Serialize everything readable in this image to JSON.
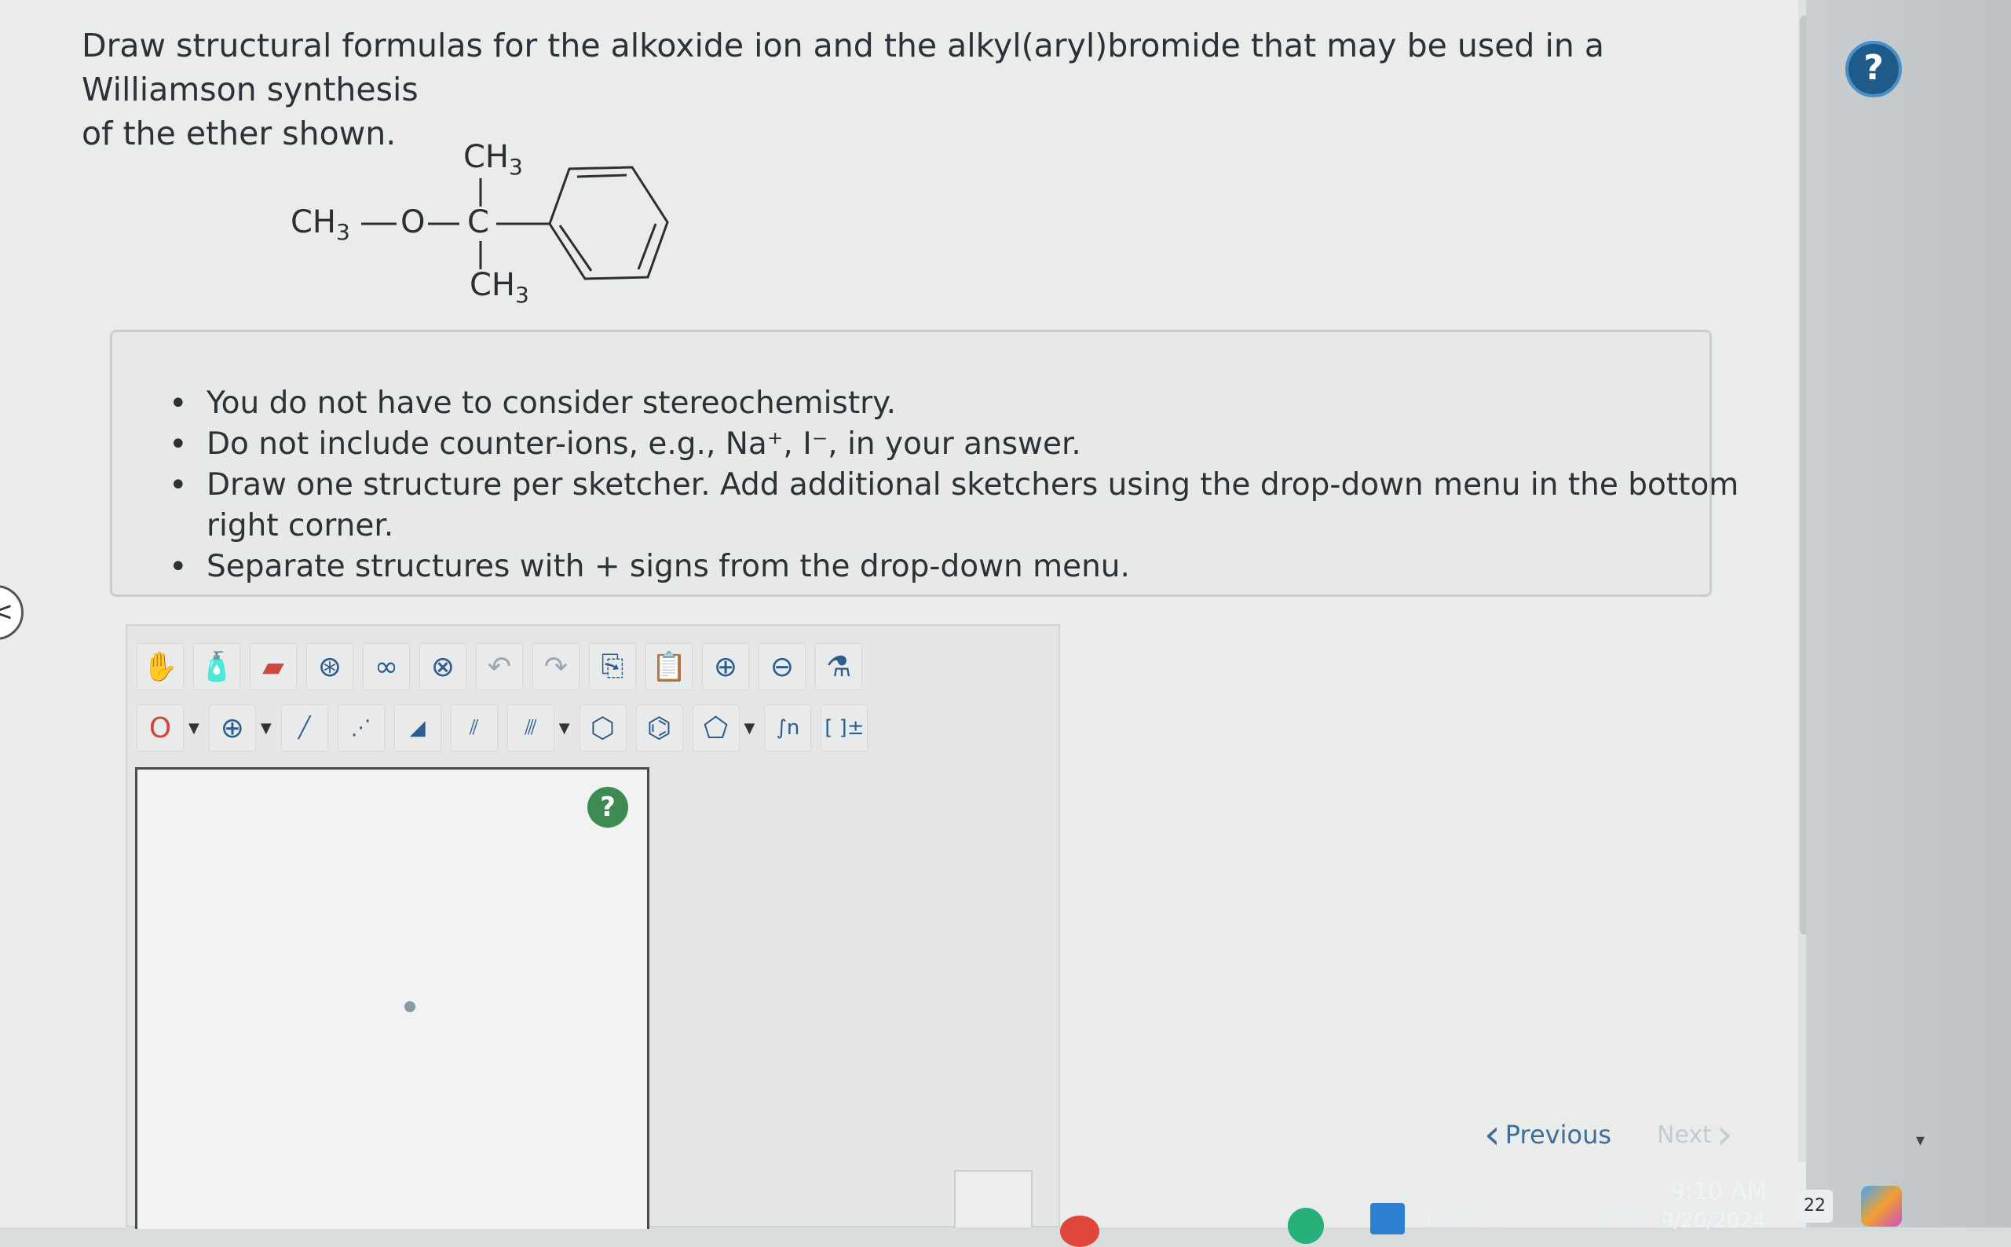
{
  "question": {
    "line1": "Draw structural formulas for the alkoxide ion and the alkyl(aryl)bromide that may be used in a Williamson synthesis",
    "line2": "of the ether shown."
  },
  "molecule": {
    "methyl_left": "CH",
    "methyl_left_sub": "3",
    "oxygen": "O",
    "carbon": "C",
    "methyl_top": "CH",
    "methyl_top_sub": "3",
    "methyl_bottom": "CH",
    "methyl_bottom_sub": "3"
  },
  "instructions": [
    "You do not have to consider stereochemistry.",
    "Do not include counter-ions, e.g., Na⁺, I⁻, in your answer.",
    "Draw one structure per sketcher. Add additional sketchers using the drop-down menu in the bottom right corner.",
    "Separate structures with + signs from the drop-down menu."
  ],
  "toolbar": {
    "top_tools": [
      "hand-icon",
      "bottle-icon",
      "eraser-icon",
      "ring-template-icon",
      "chain-icon",
      "atom-map-icon",
      "undo-icon",
      "redo-icon",
      "copy-icon",
      "paste-icon",
      "zoom-in-icon",
      "zoom-out-icon",
      "clean-icon"
    ],
    "element_selector": "O",
    "bracket_label": "[ ]±"
  },
  "navigation": {
    "previous_label": "Previous",
    "next_label": "Next"
  },
  "taskbar": {
    "weather": "Earn...",
    "language": "ENG",
    "time": "9:10 AM",
    "date": "9/20/2024",
    "notifications": "22"
  }
}
